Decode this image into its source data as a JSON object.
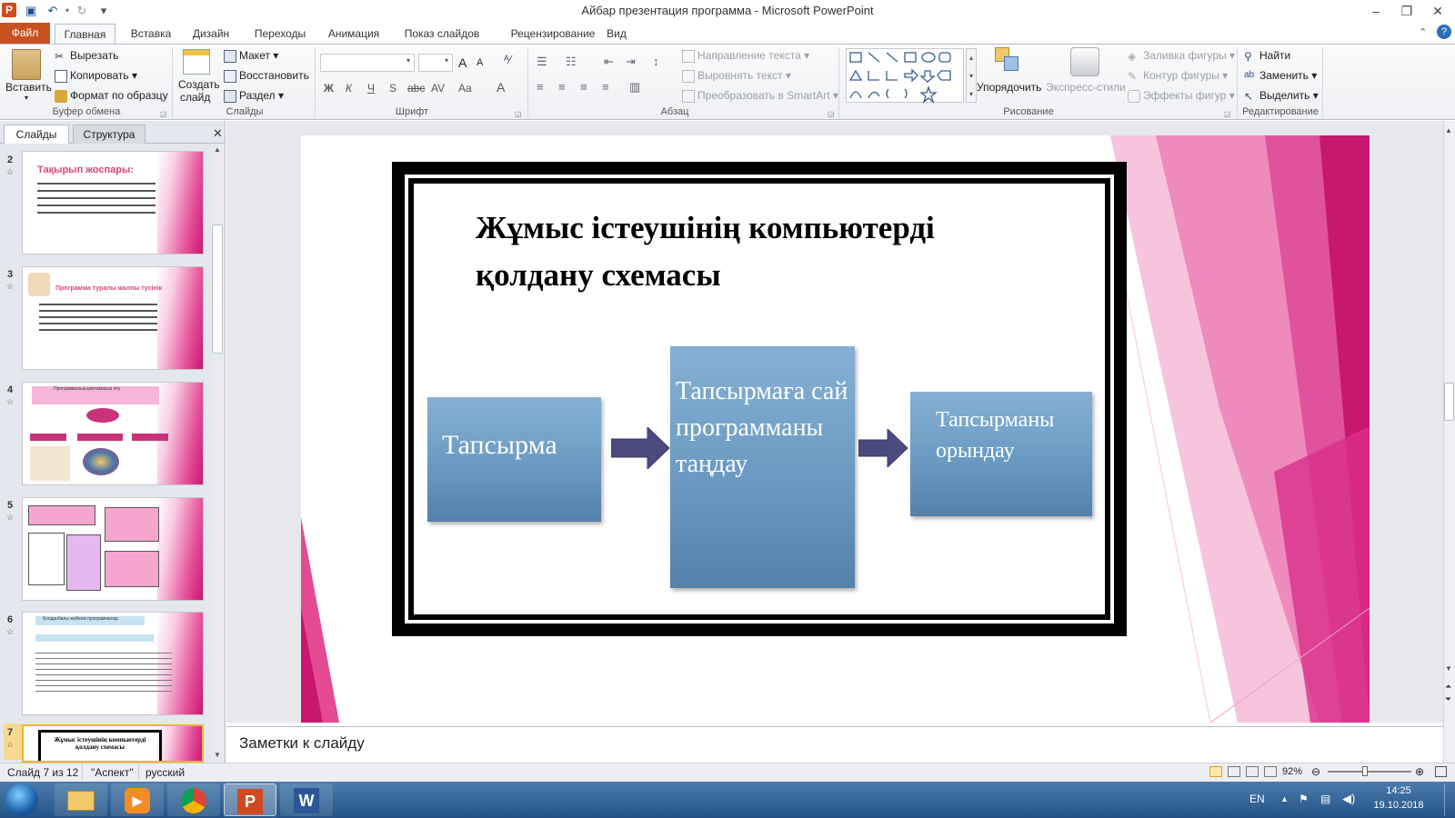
{
  "window": {
    "title": "Айбар презентация программа - Microsoft PowerPoint"
  },
  "quick_access": {
    "save_icon": "save-icon",
    "undo_icon": "undo-icon",
    "redo_icon": "redo-icon"
  },
  "tabs": [
    "Файл",
    "Главная",
    "Вставка",
    "Дизайн",
    "Переходы",
    "Анимация",
    "Показ слайдов",
    "Рецензирование",
    "Вид"
  ],
  "ribbon": {
    "clipboard": {
      "paste": "Вставить",
      "cut": "Вырезать",
      "copy": "Копировать",
      "format_painter": "Формат по образцу",
      "label": "Буфер обмена"
    },
    "slides": {
      "new_slide_1": "Создать",
      "new_slide_2": "слайд",
      "layout": "Макет",
      "reset": "Восстановить",
      "section": "Раздел",
      "label": "Слайды"
    },
    "font": {
      "bold": "Ж",
      "italic": "К",
      "underline": "Ч",
      "shadow": "S",
      "strike": "abc",
      "spacing": "AV",
      "case": "Aa",
      "color": "A",
      "grow": "A",
      "shrink": "A",
      "label": "Шрифт"
    },
    "paragraph": {
      "text_direction": "Направление текста",
      "align_text": "Выровнять текст",
      "smartart": "Преобразовать в SmartArt",
      "label": "Абзац"
    },
    "drawing": {
      "arrange": "Упорядочить",
      "quick_styles": "Экспресс-стили",
      "shape_fill": "Заливка фигуры",
      "shape_outline": "Контур фигуры",
      "shape_effects": "Эффекты фигур",
      "label": "Рисование"
    },
    "editing": {
      "find": "Найти",
      "replace": "Заменить",
      "select": "Выделить",
      "label": "Редактирование"
    }
  },
  "left_panel": {
    "tab_slides": "Слайды",
    "tab_outline": "Структура",
    "thumbs": [
      {
        "num": "2",
        "title": "Тақырып жоспары:"
      },
      {
        "num": "3",
        "title": "Программа туралы жалпы түсінік"
      },
      {
        "num": "4",
        "title": "Программалық қамтамасыз ету"
      },
      {
        "num": "5",
        "title": ""
      },
      {
        "num": "6",
        "title": "Қолданбалы жүйелік программалар"
      },
      {
        "num": "7",
        "title": "Жұмыс істеушінің компьютерді қолдану схемасы"
      }
    ]
  },
  "slide": {
    "title": "Жұмыс істеушінің компьютерді қолдану схемасы",
    "box1": "Тапсырма",
    "box2": "Тапсырмаға сай программаны таңдау",
    "box3": "Тапсырманы орындау"
  },
  "notes": {
    "placeholder": "Заметки к слайду"
  },
  "status": {
    "slide_counter": "Слайд 7 из 12",
    "theme": "\"Аспект\"",
    "language": "русский",
    "zoom": "92%"
  },
  "taskbar": {
    "lang": "EN",
    "time": "14:25",
    "date": "19.10.2018"
  },
  "colors": {
    "file_tab": "#c7511f",
    "box": "#6a9ac2",
    "arrow": "#4b4a7e",
    "pink": "#e6559c"
  }
}
